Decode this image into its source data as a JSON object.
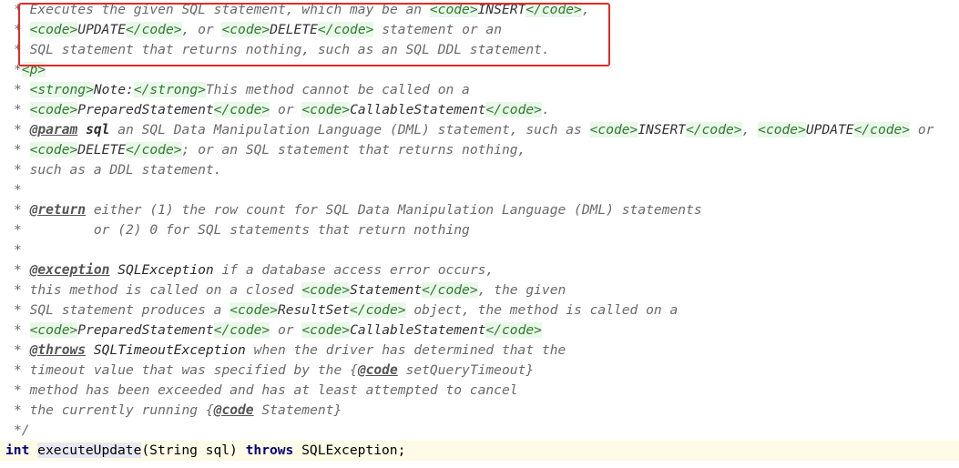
{
  "editor": {
    "javadoc_lines": [
      [
        {
          "t": "* Executes the given SQL statement, which may be an "
        },
        {
          "t": "<code>",
          "c": "tag"
        },
        {
          "t": "INSERT",
          "c": "tagtext"
        },
        {
          "t": "</code>",
          "c": "tag"
        },
        {
          "t": ","
        }
      ],
      [
        {
          "t": "* "
        },
        {
          "t": "<code>",
          "c": "tag"
        },
        {
          "t": "UPDATE",
          "c": "tagtext"
        },
        {
          "t": "</code>",
          "c": "tag"
        },
        {
          "t": ", or "
        },
        {
          "t": "<code>",
          "c": "tag"
        },
        {
          "t": "DELETE",
          "c": "tagtext"
        },
        {
          "t": "</code>",
          "c": "tag"
        },
        {
          "t": " statement or an"
        }
      ],
      [
        {
          "t": "* SQL statement that returns nothing, such as an SQL DDL statement."
        }
      ],
      [
        {
          "t": "*"
        },
        {
          "t": "<p>",
          "c": "tag"
        }
      ],
      [
        {
          "t": "* "
        },
        {
          "t": "<strong>",
          "c": "tag"
        },
        {
          "t": "Note:",
          "c": "tagtext"
        },
        {
          "t": "</strong>",
          "c": "tag"
        },
        {
          "t": "This method cannot be called on a"
        }
      ],
      [
        {
          "t": "* "
        },
        {
          "t": "<code>",
          "c": "tag"
        },
        {
          "t": "PreparedStatement",
          "c": "tagtext"
        },
        {
          "t": "</code>",
          "c": "tag"
        },
        {
          "t": " or "
        },
        {
          "t": "<code>",
          "c": "tag"
        },
        {
          "t": "CallableStatement",
          "c": "tagtext"
        },
        {
          "t": "</code>",
          "c": "tag"
        },
        {
          "t": "."
        }
      ],
      [
        {
          "t": "* "
        },
        {
          "t": "@param",
          "c": "doctag"
        },
        {
          "t": " "
        },
        {
          "t": "sql",
          "c": "pname"
        },
        {
          "t": " an SQL Data Manipulation Language (DML) statement, such as "
        },
        {
          "t": "<code>",
          "c": "tag"
        },
        {
          "t": "INSERT",
          "c": "tagtext"
        },
        {
          "t": "</code>",
          "c": "tag"
        },
        {
          "t": ", "
        },
        {
          "t": "<code>",
          "c": "tag"
        },
        {
          "t": "UPDATE",
          "c": "tagtext"
        },
        {
          "t": "</code>",
          "c": "tag"
        },
        {
          "t": " or"
        }
      ],
      [
        {
          "t": "* "
        },
        {
          "t": "<code>",
          "c": "tag"
        },
        {
          "t": "DELETE",
          "c": "tagtext"
        },
        {
          "t": "</code>",
          "c": "tag"
        },
        {
          "t": "; or an SQL statement that returns nothing,"
        }
      ],
      [
        {
          "t": "* such as a DDL statement."
        }
      ],
      [
        {
          "t": "*"
        }
      ],
      [
        {
          "t": "* "
        },
        {
          "t": "@return",
          "c": "doctag"
        },
        {
          "t": " either (1) the row count for SQL Data Manipulation Language (DML) statements"
        }
      ],
      [
        {
          "t": "*         or (2) 0 for SQL statements that return nothing"
        }
      ],
      [
        {
          "t": "*"
        }
      ],
      [
        {
          "t": "* "
        },
        {
          "t": "@exception",
          "c": "doctag"
        },
        {
          "t": " "
        },
        {
          "t": "SQLException",
          "c": "ref"
        },
        {
          "t": " if a database access error occurs,"
        }
      ],
      [
        {
          "t": "* this method is called on a closed "
        },
        {
          "t": "<code>",
          "c": "tag"
        },
        {
          "t": "Statement",
          "c": "tagtext"
        },
        {
          "t": "</code>",
          "c": "tag"
        },
        {
          "t": ", the given"
        }
      ],
      [
        {
          "t": "* SQL statement produces a "
        },
        {
          "t": "<code>",
          "c": "tag"
        },
        {
          "t": "ResultSet",
          "c": "tagtext"
        },
        {
          "t": "</code>",
          "c": "tag"
        },
        {
          "t": " object, the method is called on a"
        }
      ],
      [
        {
          "t": "* "
        },
        {
          "t": "<code>",
          "c": "tag"
        },
        {
          "t": "PreparedStatement",
          "c": "tagtext"
        },
        {
          "t": "</code>",
          "c": "tag"
        },
        {
          "t": " or "
        },
        {
          "t": "<code>",
          "c": "tag"
        },
        {
          "t": "CallableStatement",
          "c": "tagtext"
        },
        {
          "t": "</code>",
          "c": "tag"
        }
      ],
      [
        {
          "t": "* "
        },
        {
          "t": "@throws",
          "c": "doctag"
        },
        {
          "t": " "
        },
        {
          "t": "SQLTimeoutException",
          "c": "ref"
        },
        {
          "t": " when the driver has determined that the"
        }
      ],
      [
        {
          "t": "* timeout value that was specified by the {"
        },
        {
          "t": "@code",
          "c": "doctag"
        },
        {
          "t": " setQueryTimeout}"
        }
      ],
      [
        {
          "t": "* method has been exceeded and has at least attempted to cancel"
        }
      ],
      [
        {
          "t": "* the currently running {"
        },
        {
          "t": "@code",
          "c": "doctag"
        },
        {
          "t": " Statement}"
        }
      ],
      [
        {
          "t": "*/"
        }
      ]
    ],
    "signature": {
      "return_type": "int",
      "method_name": "executeUpdate",
      "params": "(String sql) ",
      "throws_kw": "throws",
      "exception": " SQLException;"
    },
    "highlight_color": "#e32a2a"
  }
}
